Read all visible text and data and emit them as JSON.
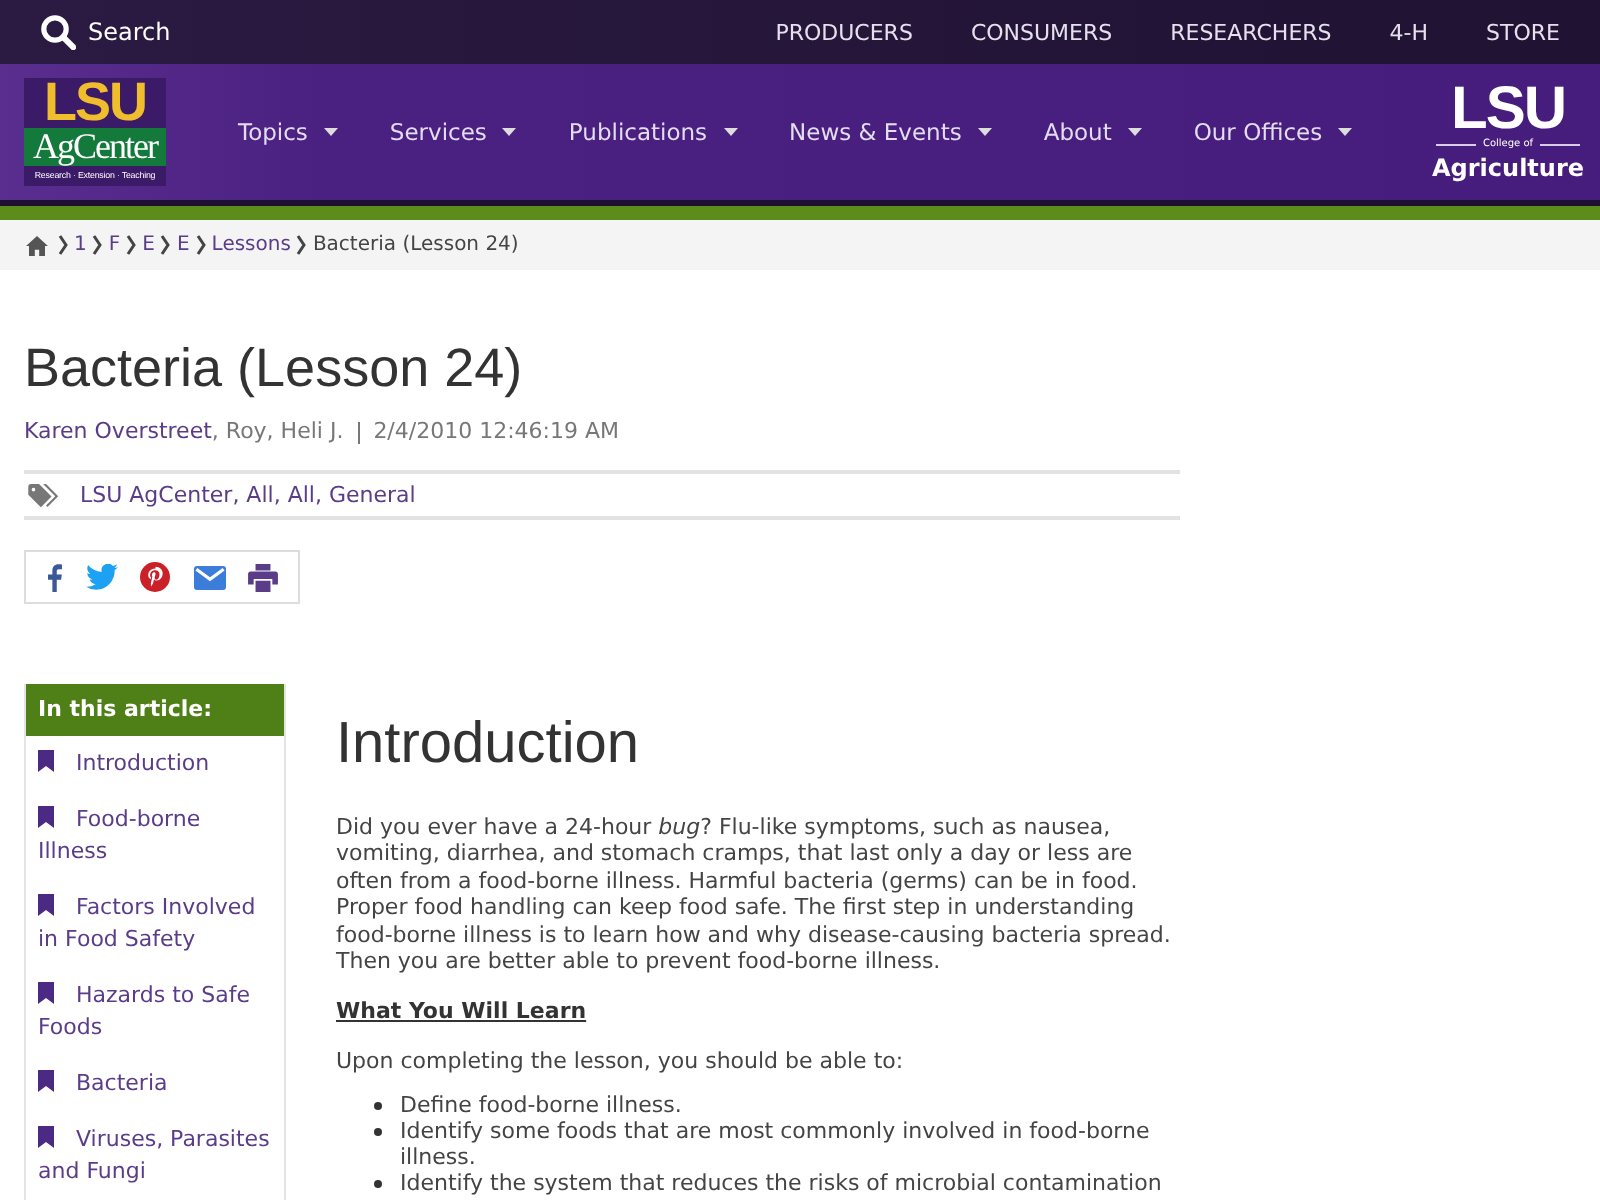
{
  "top_bar": {
    "search_label": "Search",
    "links": [
      "PRODUCERS",
      "CONSUMERS",
      "RESEARCHERS",
      "4-H",
      "STORE"
    ]
  },
  "header": {
    "logo": {
      "mark": "LSU",
      "name": "AgCenter",
      "tagline": "Research · Extension · Teaching"
    },
    "nav": [
      {
        "label": "Topics",
        "has_menu": true
      },
      {
        "label": "Services",
        "has_menu": true
      },
      {
        "label": "Publications",
        "has_menu": true
      },
      {
        "label": "News & Events",
        "has_menu": true
      },
      {
        "label": "About",
        "has_menu": true
      },
      {
        "label": "Our Offices",
        "has_menu": true
      }
    ],
    "partner_logo": {
      "mark": "LSU",
      "line_1": "College of",
      "line_2": "Agriculture"
    }
  },
  "breadcrumb": [
    {
      "label": "1",
      "current": false
    },
    {
      "label": "F",
      "current": false
    },
    {
      "label": "E",
      "current": false
    },
    {
      "label": "E",
      "current": false
    },
    {
      "label": "Lessons",
      "current": false
    },
    {
      "label": "Bacteria (Lesson 24)",
      "current": true
    }
  ],
  "article": {
    "title": "Bacteria (Lesson 24)",
    "author_link": "Karen Overstreet",
    "byline_rest": ", Roy, Heli J.",
    "date": "2/4/2010 12:46:19 AM",
    "tags": "LSU AgCenter, All, All, General",
    "share": [
      {
        "kind": "facebook"
      },
      {
        "kind": "twitter"
      },
      {
        "kind": "pinterest"
      },
      {
        "kind": "email"
      },
      {
        "kind": "print"
      }
    ]
  },
  "toc": {
    "title": "In this article:",
    "items": [
      "Introduction",
      "Food-borne Illness",
      "Factors Involved in Food Safety",
      "Hazards to Safe Foods",
      "Bacteria",
      "Viruses, Parasites and Fungi"
    ]
  },
  "content": {
    "heading": "Introduction",
    "intro": "Did you ever have a 24-hour *bug*? Flu-like symptoms, such as nausea, vomiting, diarrhea, and stomach cramps, that last only a day or less are often from a food-borne illness. Harmful bacteria (germs) can be in food. Proper food handling can keep food safe. The first step in understanding food-borne illness is to learn how and why disease-causing bacteria spread. Then you are better able to prevent food-borne illness.",
    "subheading": "What You Will Learn",
    "lead": "Upon completing the lesson, you should be able to:",
    "objectives": [
      "Define food-borne illness.",
      "Identify some foods that are most commonly involved in food-borne illness.",
      "Identify the system that reduces the risks of microbial contamination"
    ]
  }
}
